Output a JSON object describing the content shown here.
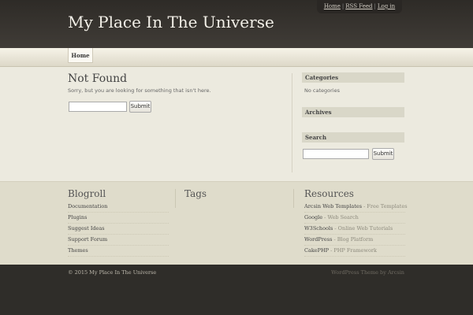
{
  "header": {
    "title": "My Place In The Universe",
    "top_links": [
      "Home",
      "RSS Feed",
      "Log in"
    ],
    "separator": "|"
  },
  "nav": {
    "tabs": [
      {
        "label": "Home"
      }
    ]
  },
  "main": {
    "title": "Not Found",
    "message": "Sorry, but you are looking for something that isn't here.",
    "search_value": "",
    "search_button": "Submit"
  },
  "sidebar": {
    "categories": {
      "title": "Categories",
      "text": "No categories"
    },
    "archives": {
      "title": "Archives"
    },
    "search": {
      "title": "Search",
      "value": "",
      "button": "Submit"
    }
  },
  "footer_columns": {
    "blogroll": {
      "title": "Blogroll",
      "links": [
        "Documentation",
        "Plugins",
        "Suggest Ideas",
        "Support Forum",
        "Themes"
      ]
    },
    "tags": {
      "title": "Tags"
    },
    "resources": {
      "title": "Resources",
      "links": [
        {
          "name": "Arcsin Web Templates",
          "desc": " - Free Templates"
        },
        {
          "name": "Google",
          "desc": " - Web Search"
        },
        {
          "name": "W3Schools",
          "desc": " - Online Web Tutorials"
        },
        {
          "name": "WordPress",
          "desc": " - Blog Platform"
        },
        {
          "name": "CakePHP",
          "desc": " - PHP Framework"
        }
      ]
    }
  },
  "bottom": {
    "copyright": "© 2015 My Place In The Universe",
    "credit": "WordPress Theme by Arcsin"
  }
}
